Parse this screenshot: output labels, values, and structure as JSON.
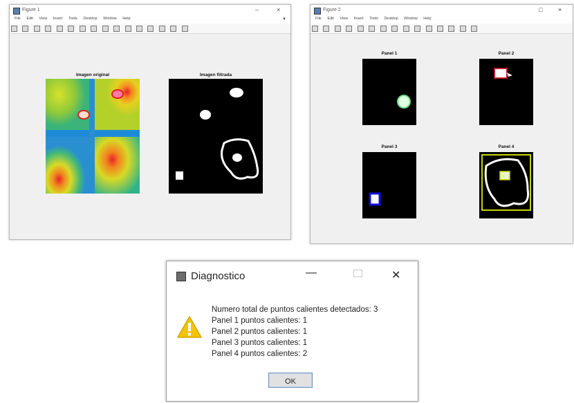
{
  "window1": {
    "title": "Figure 1",
    "menu": [
      "File",
      "Edit",
      "View",
      "Insert",
      "Tools",
      "Desktop",
      "Window",
      "Help"
    ],
    "axes": [
      {
        "title": "Imagen original"
      },
      {
        "title": "Imagen filtrada"
      }
    ]
  },
  "window2": {
    "title": "Figure 2",
    "menu": [
      "File",
      "Edit",
      "View",
      "Insert",
      "Tools",
      "Desktop",
      "Window",
      "Help"
    ],
    "panels": [
      {
        "title": "Panel 1",
        "marker_color": "#6fdc8c"
      },
      {
        "title": "Panel 2",
        "marker_color": "#c0182a"
      },
      {
        "title": "Panel 3",
        "marker_color": "#1010e0"
      },
      {
        "title": "Panel 4",
        "marker_color": "#c9d400"
      }
    ]
  },
  "dialog": {
    "title": "Diagnostico",
    "lines": [
      "Numero total de puntos calientes detectados: 3",
      "Panel 1 puntos calientes: 1",
      "Panel 2 puntos calientes: 1",
      "Panel 3 puntos calientes: 1",
      "Panel 4 puntos calientes: 2"
    ],
    "ok_label": "OK",
    "icons": {
      "app": "java-cup-icon",
      "warning": "warning-icon"
    }
  }
}
